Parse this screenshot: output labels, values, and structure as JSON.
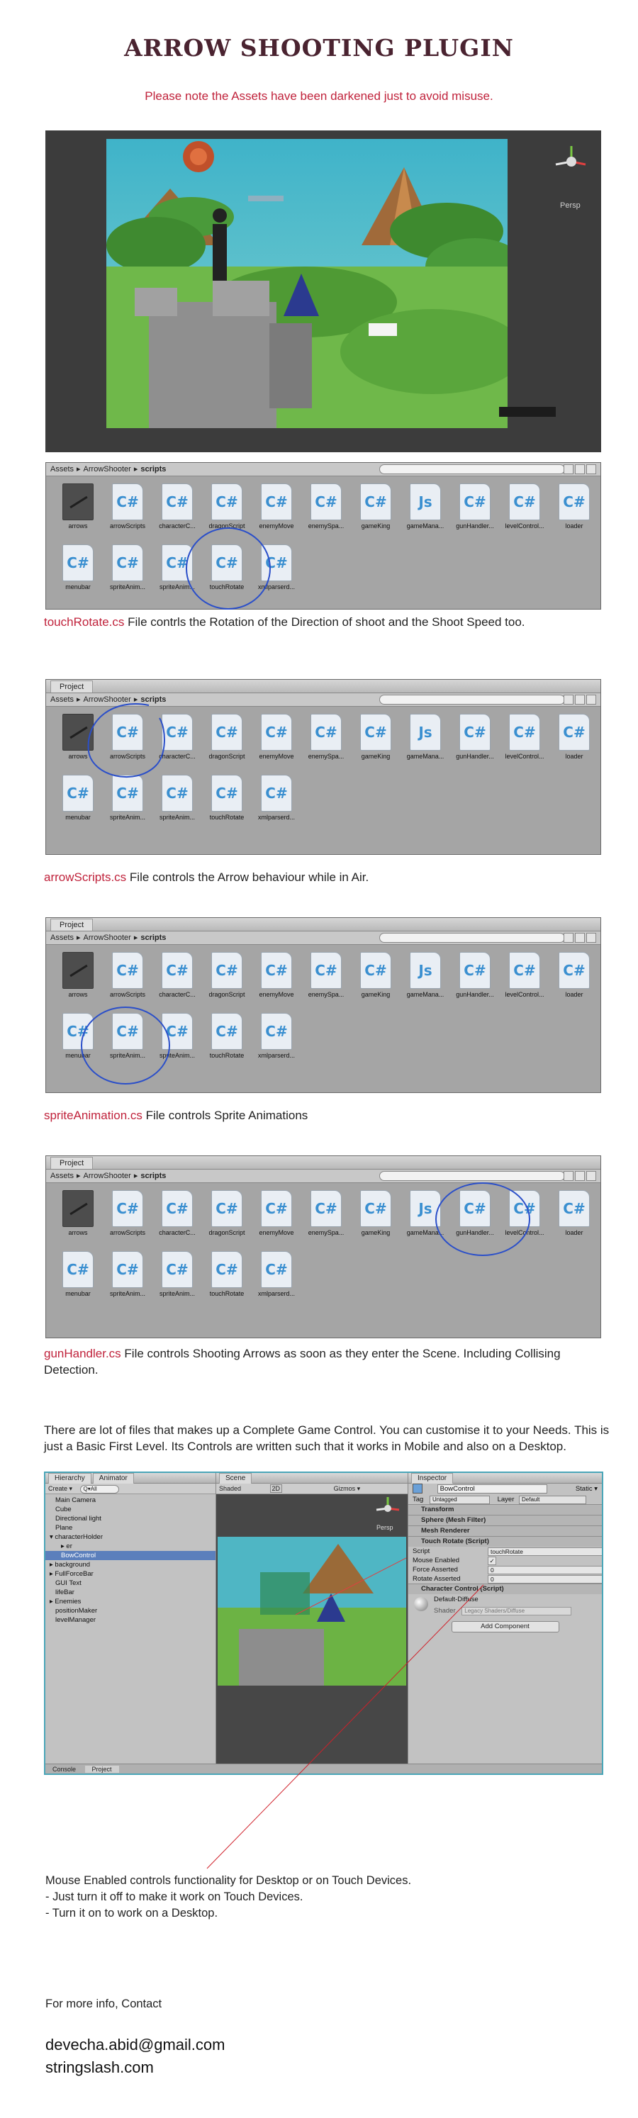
{
  "title": "ARROW SHOOTING PLUGIN",
  "notice": "Please note the Assets have been darkened just to avoid misuse.",
  "scene_view": {
    "persp_label": "Persp"
  },
  "project": {
    "tab_label": "Project",
    "breadcrumb": [
      "Assets",
      "ArrowShooter",
      "scripts"
    ],
    "breadcrumb_sep": "▸",
    "files": [
      {
        "name": "arrows",
        "icon": "texture-icon"
      },
      {
        "name": "arrowScripts",
        "icon": "cs-script-icon"
      },
      {
        "name": "characterC...",
        "icon": "cs-script-icon"
      },
      {
        "name": "dragonScript",
        "icon": "cs-script-icon"
      },
      {
        "name": "enemyMove",
        "icon": "cs-script-icon"
      },
      {
        "name": "enemySpa...",
        "icon": "cs-script-icon"
      },
      {
        "name": "gameKing",
        "icon": "cs-script-icon"
      },
      {
        "name": "gameMana...",
        "icon": "js-script-icon"
      },
      {
        "name": "gunHandler...",
        "icon": "cs-script-icon"
      },
      {
        "name": "levelControl...",
        "icon": "cs-script-icon"
      },
      {
        "name": "loader",
        "icon": "cs-script-icon"
      },
      {
        "name": "menubar",
        "icon": "cs-script-icon"
      },
      {
        "name": "spriteAnim...",
        "icon": "cs-script-icon"
      },
      {
        "name": "spriteAnim...",
        "icon": "cs-script-icon"
      },
      {
        "name": "touchRotate",
        "icon": "cs-script-icon"
      },
      {
        "name": "xmlparserd...",
        "icon": "cs-script-icon"
      }
    ],
    "cs_glyph": "C#",
    "js_glyph": "Js"
  },
  "captions": [
    {
      "file": "touchRotate.cs",
      "text": " File contrls the Rotation of the Direction of shoot and the Shoot Speed too."
    },
    {
      "file": "arrowScripts.cs",
      "text": " File controls the Arrow behaviour while in Air."
    },
    {
      "file": "spriteAnimation.cs",
      "text": " File controls Sprite Animations"
    },
    {
      "file": "gunHandler.cs",
      "text": " File controls Shooting Arrows as soon as they enter the Scene. Including Collising Detection."
    }
  ],
  "intro": "There are lot of files that makes up a Complete Game Control. You can customise it to your Needs. This is just a Basic First Level. Its Controls are written such that it works in Mobile and also on a Desktop.",
  "editor": {
    "hierarchy_tab": "Hierarchy",
    "animator_tab": "Animator",
    "create_label": "Create ▾",
    "search_placeholder": "Q▾All",
    "hierarchy_items": [
      {
        "label": "Main Camera",
        "indent": 1
      },
      {
        "label": "Cube",
        "indent": 1
      },
      {
        "label": "Directional light",
        "indent": 1
      },
      {
        "label": "Plane",
        "indent": 1
      },
      {
        "label": "▾ characterHolder",
        "indent": 0
      },
      {
        "label": "▸ er",
        "indent": 2
      },
      {
        "label": "BowControl",
        "indent": 2,
        "selected": true
      },
      {
        "label": "▸ background",
        "indent": 0
      },
      {
        "label": "▸ FullForceBar",
        "indent": 0
      },
      {
        "label": "GUI Text",
        "indent": 1
      },
      {
        "label": "lifeBar",
        "indent": 1
      },
      {
        "label": "▸ Enemies",
        "indent": 0
      },
      {
        "label": "positionMaker",
        "indent": 1
      },
      {
        "label": "levelManager",
        "indent": 1
      }
    ],
    "scene_tab": "Scene",
    "scene_toolbar": {
      "shaded": "Shaded",
      "mode_2d": "2D",
      "gizmos": "Gizmos ▾"
    },
    "persp_label": "Persp",
    "inspector_tab": "Inspector",
    "object_name": "BowControl",
    "static_label": "Static ▾",
    "tag_label": "Tag",
    "tag_value": "Untagged",
    "layer_label": "Layer",
    "layer_value": "Default",
    "components": [
      {
        "label": "Transform"
      },
      {
        "label": "Sphere (Mesh Filter)"
      },
      {
        "label": "Mesh Renderer"
      },
      {
        "label": "Touch Rotate (Script)"
      }
    ],
    "script_fields": [
      {
        "label": "Script",
        "value": "touchRotate"
      },
      {
        "label": "Mouse Enabled",
        "value": "✓"
      },
      {
        "label": "Force Asserted",
        "value": "0"
      },
      {
        "label": "Rotate Asserted",
        "value": "0"
      }
    ],
    "character_control": "Character Control (Script)",
    "material": "Default-Diffuse",
    "shader_label": "Shader",
    "shader_value": "Legacy Shaders/Diffuse",
    "add_component": "Add Component",
    "bottom_tabs": [
      "Console",
      "Project"
    ]
  },
  "mouse_note": [
    "Mouse Enabled controls functionality for Desktop or on Touch Devices.",
    "- Just turn it off to make it work on Touch Devices.",
    "- Turn it on to work on a Desktop."
  ],
  "contact": {
    "label": "For more info, Contact",
    "email": "devecha.abid@gmail.com",
    "site": "stringslash.com"
  },
  "colors": {
    "accent_red": "#c0223b",
    "title": "#4a2330",
    "circle": "#2b4fc9"
  }
}
